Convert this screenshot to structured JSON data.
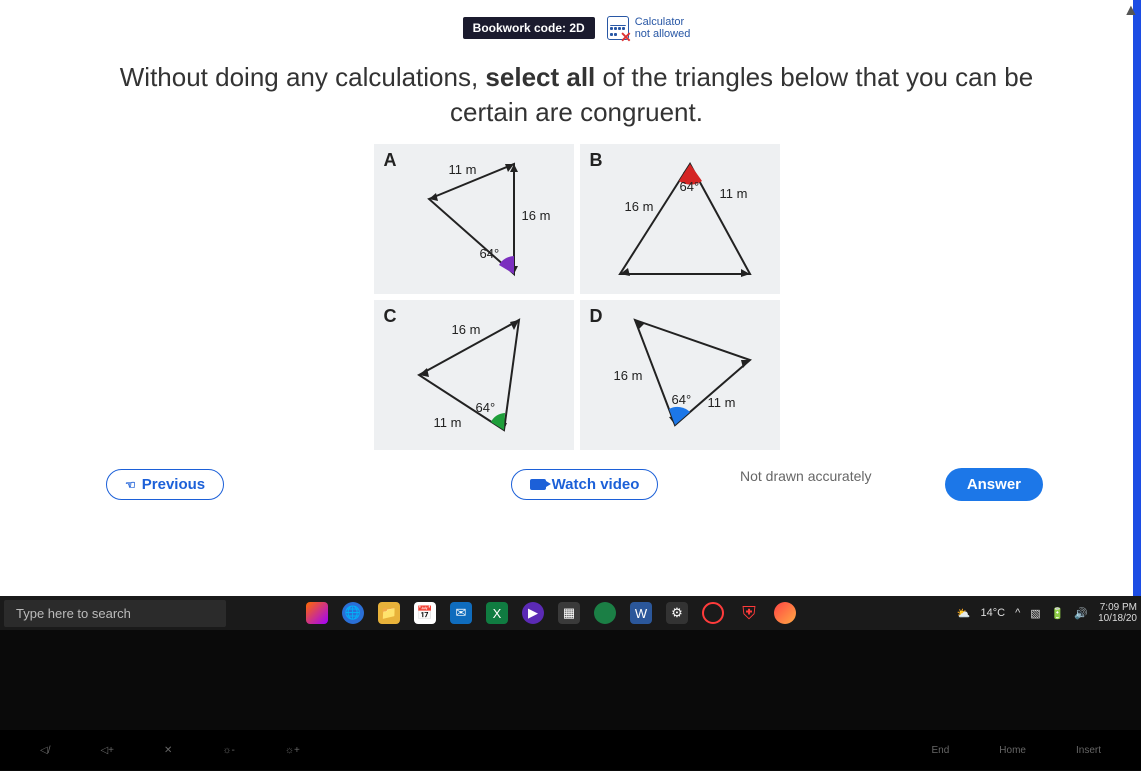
{
  "header": {
    "bookwork_label": "Bookwork code: 2D",
    "calc_line1": "Calculator",
    "calc_line2": "not allowed"
  },
  "question": {
    "part1": "Without doing any calculations, ",
    "bold": "select all",
    "part2": " of the triangles below that you can be certain are congruent."
  },
  "triangles": {
    "A": {
      "letter": "A",
      "side1": "11 m",
      "side2": "16 m",
      "angle": "64°"
    },
    "B": {
      "letter": "B",
      "side1": "16 m",
      "side2": "11 m",
      "angle": "64°"
    },
    "C": {
      "letter": "C",
      "side1": "16 m",
      "side2": "11 m",
      "angle": "64°"
    },
    "D": {
      "letter": "D",
      "side1": "16 m",
      "side2": "11 m",
      "angle": "64°"
    }
  },
  "note": "Not drawn accurately",
  "buttons": {
    "previous": "Previous",
    "watch": "Watch video",
    "answer": "Answer"
  },
  "url": "xmaths.uk/student/package/ec80f034-7776-4e3f-8cd3-cd0bdeca8b01/task/2/item/3",
  "taskbar": {
    "search_placeholder": "Type here to search",
    "weather": "14°C",
    "time": "7:09 PM",
    "date": "10/18/20"
  },
  "keyboard": {
    "k1": "◁/",
    "k2": "◁+",
    "k3": "✕",
    "k4": "☼-",
    "k5": "☼+",
    "k6": "",
    "k7": "",
    "k8": "",
    "k9": "End",
    "k10": "Home",
    "k11": "Insert"
  }
}
